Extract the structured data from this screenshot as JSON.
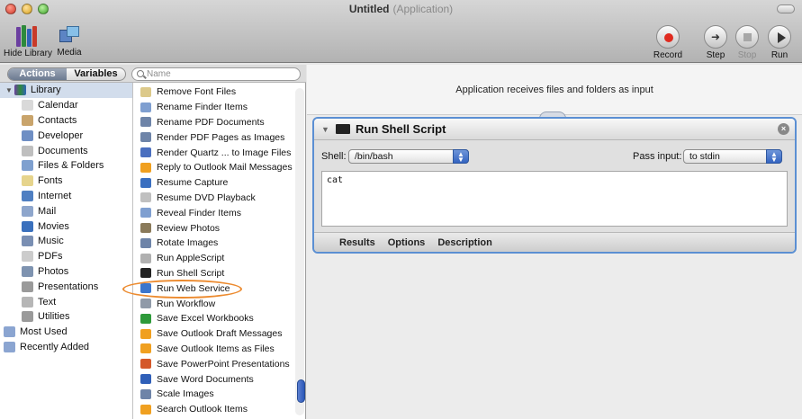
{
  "window": {
    "title": "Untitled",
    "subtitle": "(Application)"
  },
  "toolbar": {
    "hide_library": "Hide Library",
    "media": "Media",
    "record": "Record",
    "step": "Step",
    "stop": "Stop",
    "run": "Run"
  },
  "tabs": {
    "actions": "Actions",
    "variables": "Variables"
  },
  "search": {
    "placeholder": "Name"
  },
  "library": {
    "root": "Library",
    "items": [
      {
        "label": "Calendar",
        "icon": "calendar-icon",
        "color": "#d9d9d9"
      },
      {
        "label": "Contacts",
        "icon": "contacts-icon",
        "color": "#c9a46b"
      },
      {
        "label": "Developer",
        "icon": "developer-icon",
        "color": "#6f8fc4"
      },
      {
        "label": "Documents",
        "icon": "documents-icon",
        "color": "#bfbfbf"
      },
      {
        "label": "Files & Folders",
        "icon": "files-folders-icon",
        "color": "#7fa0cf"
      },
      {
        "label": "Fonts",
        "icon": "fonts-icon",
        "color": "#e6d48c"
      },
      {
        "label": "Internet",
        "icon": "internet-icon",
        "color": "#4f7fc2"
      },
      {
        "label": "Mail",
        "icon": "mail-icon",
        "color": "#8ea6cc"
      },
      {
        "label": "Movies",
        "icon": "movies-icon",
        "color": "#3a70bd"
      },
      {
        "label": "Music",
        "icon": "music-icon",
        "color": "#7a8fb3"
      },
      {
        "label": "PDFs",
        "icon": "pdfs-icon",
        "color": "#cccccc"
      },
      {
        "label": "Photos",
        "icon": "photos-icon",
        "color": "#7e93b0"
      },
      {
        "label": "Presentations",
        "icon": "presentations-icon",
        "color": "#9a9a9a"
      },
      {
        "label": "Text",
        "icon": "text-icon",
        "color": "#b6b6b6"
      },
      {
        "label": "Utilities",
        "icon": "utilities-icon",
        "color": "#9a9a9a"
      }
    ],
    "extras": [
      {
        "label": "Most Used",
        "icon": "most-used-icon",
        "color": "#8ba5d1"
      },
      {
        "label": "Recently Added",
        "icon": "recently-added-icon",
        "color": "#8ba5d1"
      }
    ]
  },
  "actions_list": [
    {
      "label": "Remove Font Files",
      "icon": "font-file-icon",
      "color": "#dcc98a"
    },
    {
      "label": "Rename Finder Items",
      "icon": "finder-icon",
      "color": "#7f9fd0"
    },
    {
      "label": "Rename PDF Documents",
      "icon": "photos-icon",
      "color": "#6e84a8"
    },
    {
      "label": "Render PDF Pages as Images",
      "icon": "photos-icon",
      "color": "#6e84a8"
    },
    {
      "label": "Render Quartz ... to Image Files",
      "icon": "quartz-icon",
      "color": "#4a6fbf"
    },
    {
      "label": "Reply to Outlook Mail Messages",
      "icon": "outlook-icon",
      "color": "#f0a020"
    },
    {
      "label": "Resume Capture",
      "icon": "capture-icon",
      "color": "#3a6fc0"
    },
    {
      "label": "Resume DVD Playback",
      "icon": "dvd-icon",
      "color": "#c0c0c0"
    },
    {
      "label": "Reveal Finder Items",
      "icon": "finder-icon",
      "color": "#7f9fd0"
    },
    {
      "label": "Review Photos",
      "icon": "review-photos-icon",
      "color": "#8a7a5a"
    },
    {
      "label": "Rotate Images",
      "icon": "photos-icon",
      "color": "#6e84a8"
    },
    {
      "label": "Run AppleScript",
      "icon": "applescript-icon",
      "color": "#b0b0b0"
    },
    {
      "label": "Run Shell Script",
      "icon": "terminal-icon",
      "color": "#222222"
    },
    {
      "label": "Run Web Service",
      "icon": "web-service-icon",
      "color": "#3c76cc"
    },
    {
      "label": "Run Workflow",
      "icon": "workflow-icon",
      "color": "#909aa8"
    },
    {
      "label": "Save Excel Workbooks",
      "icon": "excel-icon",
      "color": "#2e9a3a"
    },
    {
      "label": "Save Outlook Draft Messages",
      "icon": "outlook-icon",
      "color": "#f0a020"
    },
    {
      "label": "Save Outlook Items as Files",
      "icon": "outlook-icon",
      "color": "#f0a020"
    },
    {
      "label": "Save PowerPoint Presentations",
      "icon": "powerpoint-icon",
      "color": "#d4582a"
    },
    {
      "label": "Save Word Documents",
      "icon": "word-icon",
      "color": "#2f5fb8"
    },
    {
      "label": "Scale Images",
      "icon": "photos-icon",
      "color": "#6e84a8"
    },
    {
      "label": "Search Outlook Items",
      "icon": "outlook-icon",
      "color": "#f0a020"
    }
  ],
  "workflow": {
    "input_note": "Application receives files and folders as input",
    "action": {
      "title": "Run Shell Script",
      "shell_label": "Shell:",
      "shell_value": "/bin/bash",
      "pass_label": "Pass input:",
      "pass_value": "to stdin",
      "script": "cat",
      "tabs": [
        "Results",
        "Options",
        "Description"
      ]
    }
  },
  "colors": {
    "accent": "#5b8fd3",
    "callout": "#ec8a2e",
    "selection": "#d2ddec"
  }
}
